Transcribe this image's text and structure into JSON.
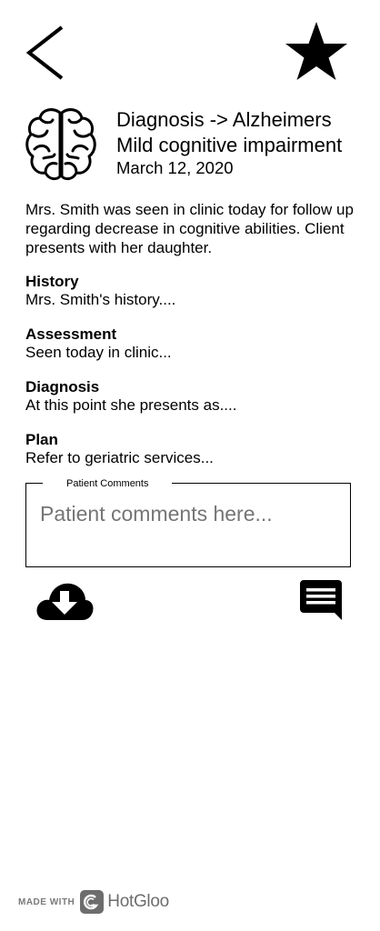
{
  "header": {
    "back_icon": "chevron-left-icon",
    "favorite_icon": "star-icon",
    "topic_icon": "brain-icon",
    "title_line1": "Diagnosis -> Alzheimers",
    "title_line2": "Mild cognitive impairment",
    "date": "March 12, 2020"
  },
  "note": {
    "summary": "Mrs. Smith was seen in clinic today for follow up regarding decrease in cognitive abilities. Client presents with her daughter.",
    "sections": [
      {
        "heading": "History",
        "text": "Mrs. Smith's history...."
      },
      {
        "heading": "Assessment",
        "text": "Seen today in clinic..."
      },
      {
        "heading": "Diagnosis",
        "text": "At this point she presents as...."
      },
      {
        "heading": "Plan",
        "text": "Refer to geriatric services..."
      }
    ]
  },
  "comments": {
    "legend": "Patient Comments",
    "placeholder": "Patient comments here..."
  },
  "actions": {
    "download_icon": "cloud-download-icon",
    "comment_icon": "comment-icon"
  },
  "footer": {
    "made_with": "MADE WITH",
    "brand": "HotGloo"
  }
}
